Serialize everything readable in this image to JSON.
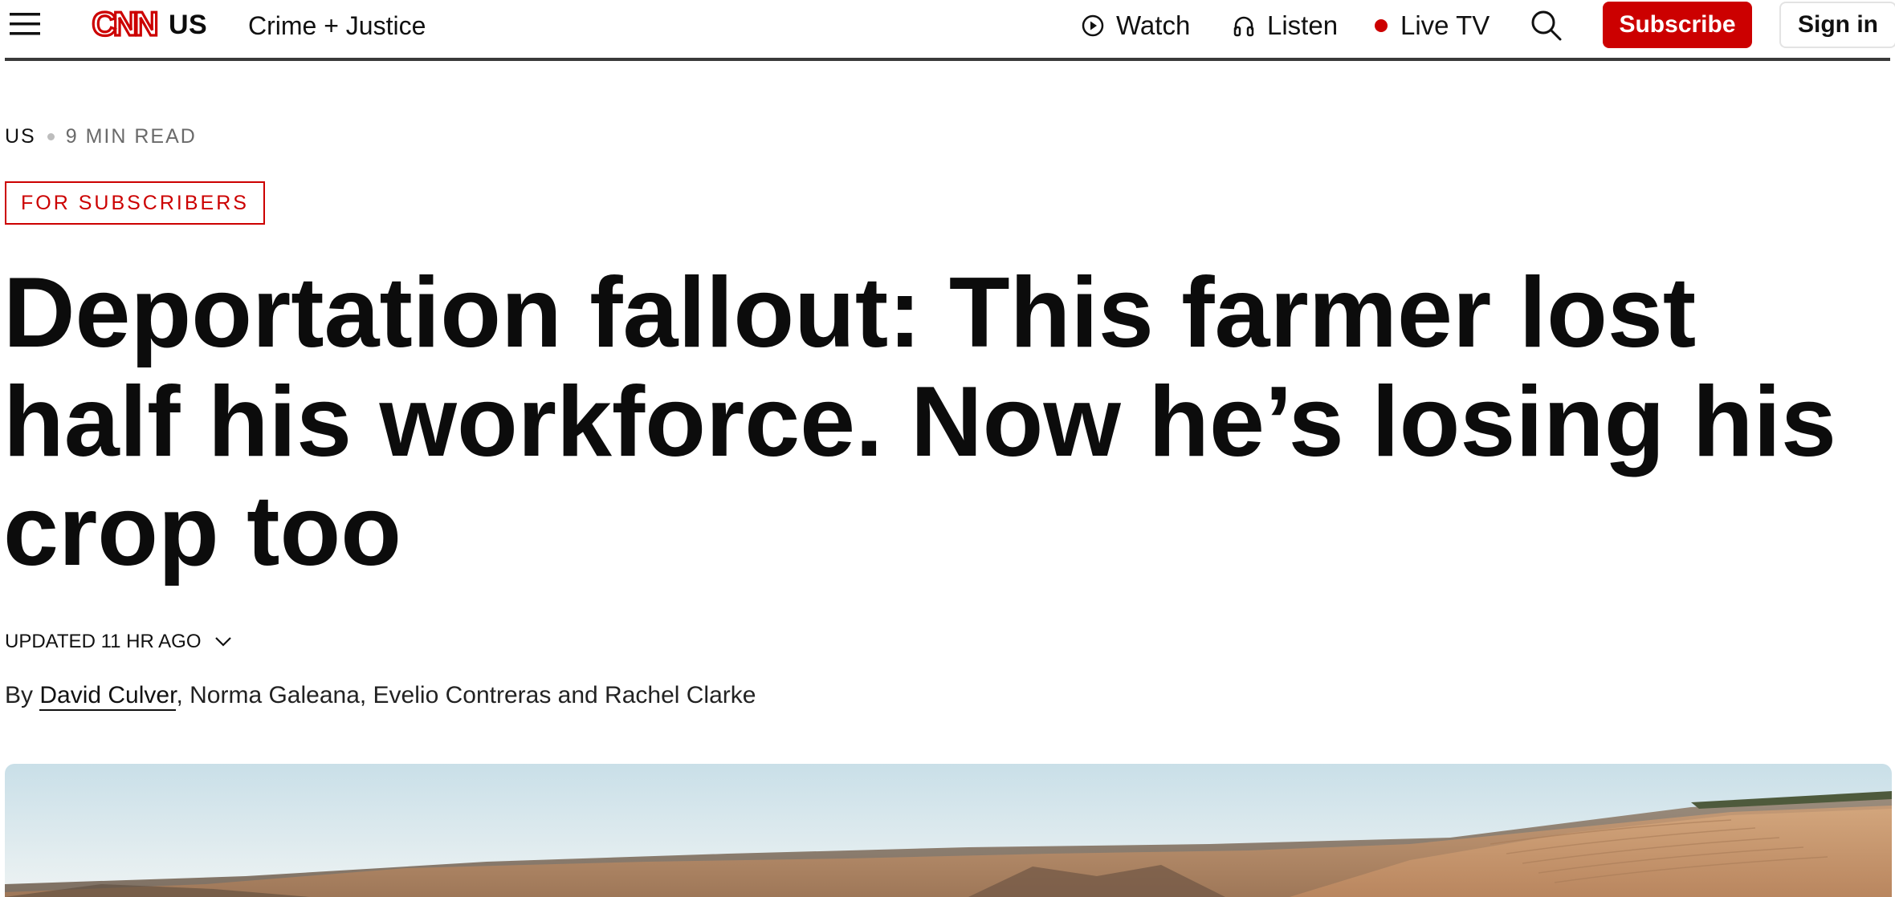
{
  "header": {
    "section": "US",
    "subnav_link": "Crime + Justice",
    "nav": {
      "watch": "Watch",
      "listen": "Listen",
      "live_tv": "Live TV"
    },
    "subscribe_label": "Subscribe",
    "signin_label": "Sign in",
    "icons": [
      "hamburger-icon",
      "cnn-logo",
      "play-circle-icon",
      "headphones-icon",
      "live-dot",
      "search-icon"
    ],
    "colors": {
      "brand": "#cc0000"
    }
  },
  "article": {
    "category": "US",
    "read_time": "9 MIN READ",
    "badge": "FOR SUBSCRIBERS",
    "headline": "Deportation fallout: This farmer lost half his workforce. Now he’s losing his crop too",
    "updated": "UPDATED 11 HR AGO",
    "byline": {
      "prefix": "By ",
      "linked_author": "David Culver",
      "rest": ", Norma Galeana, Evelio Contreras and Rachel Clarke"
    }
  }
}
